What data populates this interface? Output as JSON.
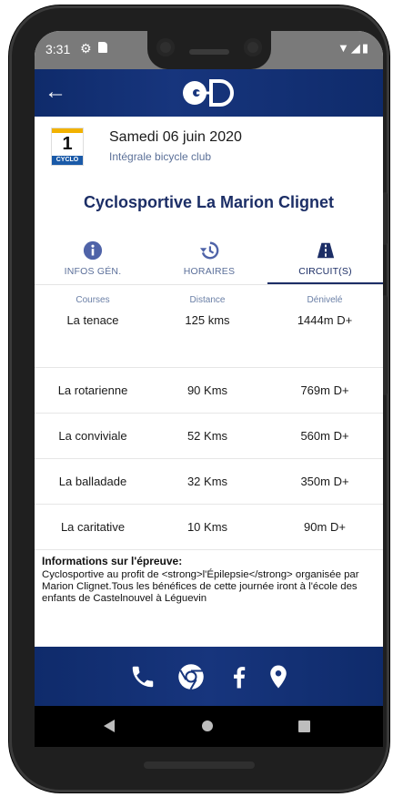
{
  "status_bar": {
    "time": "3:31",
    "right_icons": "▼◢▮"
  },
  "header": {
    "back_icon": "arrow-left-icon",
    "logo_text": "OD"
  },
  "event": {
    "category_number": "1",
    "category_label": "CYCLO",
    "date": "Samedi 06 juin 2020",
    "club": "Intégrale bicycle club",
    "title": "Cyclosportive La Marion Clignet"
  },
  "tabs": [
    {
      "label": "INFOS GÉN.",
      "icon": "info-icon"
    },
    {
      "label": "HORAIRES",
      "icon": "history-icon"
    },
    {
      "label": "CIRCUIT(S)",
      "icon": "road-icon",
      "active": true
    }
  ],
  "courses": {
    "headers": [
      "Courses",
      "Distance",
      "Dénivelé"
    ],
    "rows": [
      [
        "La tenace",
        "125 kms",
        "1444m D+"
      ],
      [
        "La rotarienne",
        "90 Kms",
        "769m D+"
      ],
      [
        "La conviviale",
        "52 Kms",
        "560m D+"
      ],
      [
        "La balladade",
        "32 Kms",
        "350m D+"
      ],
      [
        "La caritative",
        "10 Kms",
        "90m D+"
      ]
    ]
  },
  "info": {
    "heading": "Informations sur l'épreuve:",
    "body": "Cyclosportive au profit de <strong>l'Épilepsie</strong> organisée par Marion Clignet.Tous les bénéfices de cette journée iront à l'école des enfants de Castelnouvel à Léguevin"
  },
  "footer_icons": [
    "phone-icon",
    "chrome-icon",
    "facebook-icon",
    "map-pin-icon"
  ],
  "colors": {
    "brand": "#17357d",
    "title": "#1c2e66",
    "muted": "#5b7098"
  }
}
